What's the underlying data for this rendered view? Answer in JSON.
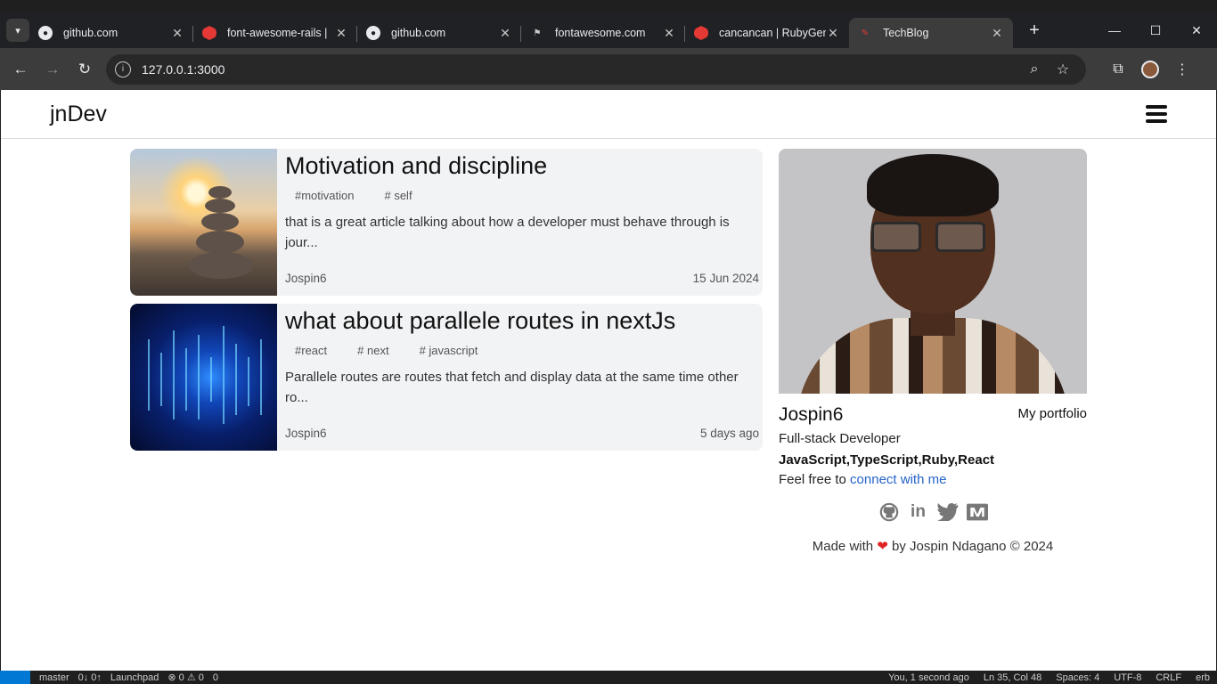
{
  "browser": {
    "tabs": [
      {
        "title": "github.com",
        "icon": "github-icon"
      },
      {
        "title": "font-awesome-rails |",
        "icon": "ruby-gems-icon"
      },
      {
        "title": "github.com",
        "icon": "github-icon"
      },
      {
        "title": "fontawesome.com",
        "icon": "flag-icon"
      },
      {
        "title": "cancancan | RubyGem",
        "icon": "ruby-gems-icon"
      },
      {
        "title": "TechBlog",
        "icon": "techblog-icon",
        "active": true
      }
    ],
    "new_tab_label": "+",
    "url": "127.0.0.1:3000"
  },
  "site": {
    "brand": "jnDev",
    "posts": [
      {
        "title": "Motivation and discipline",
        "tags": [
          "#motivation",
          "# self"
        ],
        "excerpt": "that is a great article talking about how a developer must behave through is jour...",
        "author": "Jospin6",
        "date": "15 Jun 2024"
      },
      {
        "title": "what about parallele routes in nextJs",
        "tags": [
          "#react",
          "# next",
          "# javascript"
        ],
        "excerpt": "Parallele routes are routes that fetch and display data at the same time other ro...",
        "author": "Jospin6",
        "date": "5 days ago"
      }
    ],
    "profile": {
      "name": "Jospin6",
      "portfolio_label": "My portfolio",
      "role": "Full-stack Developer",
      "skills": "JavaScript,TypeScript,Ruby,React",
      "connect_prefix": "Feel free to",
      "connect_link": "connect with me",
      "socials": [
        "github-icon",
        "linkedin-icon",
        "twitter-icon",
        "medium-icon"
      ]
    },
    "footer": {
      "made_with": "Made with",
      "heart": "❤",
      "by": "by Jospin Ndagano © 2024"
    }
  },
  "status_bar": {
    "branch": "master",
    "sync": "0↓ 0↑",
    "launchpad": "Launchpad",
    "problems": "⊗ 0 ⚠ 0",
    "ports": "0",
    "blame": "You, 1 second ago",
    "position": "Ln 35, Col 48",
    "spaces": "Spaces: 4",
    "encoding": "UTF-8",
    "eol": "CRLF",
    "language": "erb"
  },
  "colors": {
    "link": "#2563c9",
    "card_bg": "#f2f3f5",
    "heart": "#e02424"
  }
}
